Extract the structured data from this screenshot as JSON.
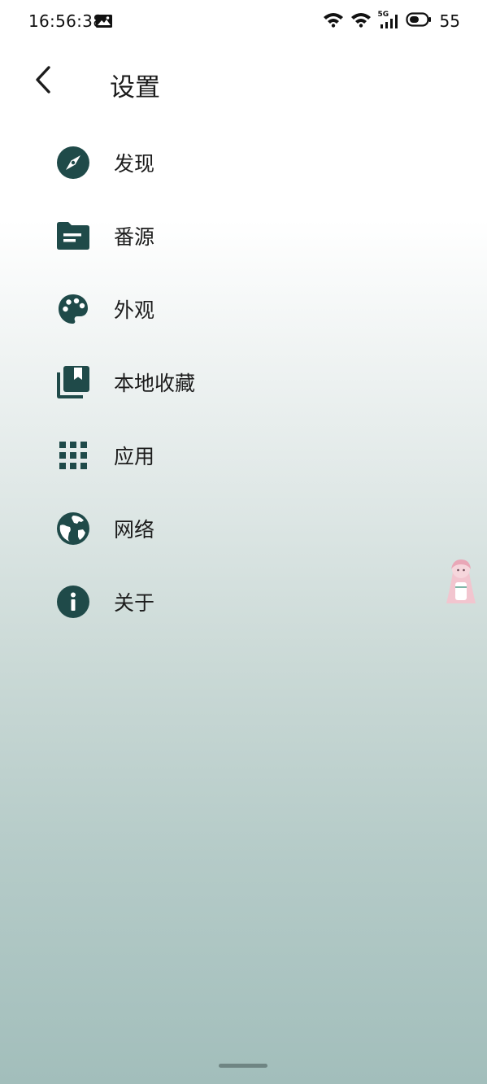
{
  "status_bar": {
    "time": "16:56:38",
    "battery_level": "55",
    "network_label": "5G"
  },
  "header": {
    "title": "设置",
    "back_icon": "chevron-left-icon"
  },
  "menu": {
    "items": [
      {
        "label": "发现",
        "icon": "compass-icon"
      },
      {
        "label": "番源",
        "icon": "folder-icon"
      },
      {
        "label": "外观",
        "icon": "palette-icon"
      },
      {
        "label": "本地收藏",
        "icon": "bookmark-library-icon"
      },
      {
        "label": "应用",
        "icon": "grid-apps-icon"
      },
      {
        "label": "网络",
        "icon": "globe-icon"
      },
      {
        "label": "关于",
        "icon": "info-icon"
      }
    ]
  },
  "colors": {
    "icon": "#1f4a49",
    "text": "#1c1c1c",
    "gradient_bottom": "#a2bebb"
  }
}
